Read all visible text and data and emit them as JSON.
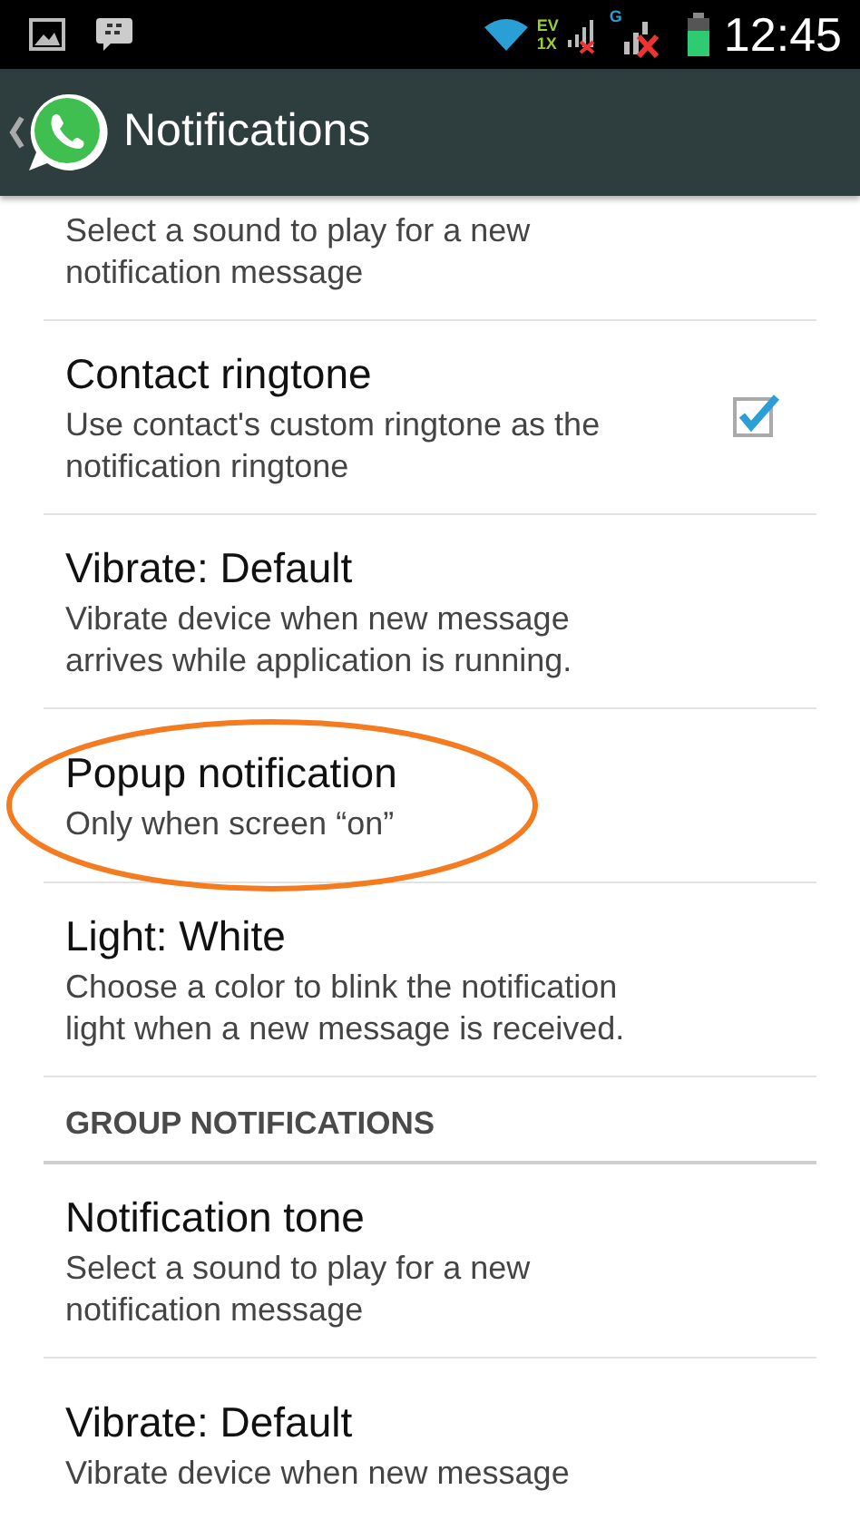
{
  "status_bar": {
    "network_labels": [
      "EV",
      "1X",
      "G"
    ],
    "time": "12:45"
  },
  "action_bar": {
    "title": "Notifications"
  },
  "sections": [
    {
      "items": [
        {
          "kind": "plain",
          "summary": "Select a sound to play for a new notification message"
        },
        {
          "kind": "checkbox",
          "title": "Contact ringtone",
          "summary": "Use contact's custom ringtone as the notification ringtone",
          "checked": true
        },
        {
          "kind": "plain",
          "title": "Vibrate: Default",
          "summary": "Vibrate device when new message arrives while application is running."
        },
        {
          "kind": "plain",
          "title": "Popup notification",
          "summary": "Only when screen “on”",
          "highlighted": true
        },
        {
          "kind": "plain",
          "title": "Light: White",
          "summary": "Choose a color to blink the notification light when a new message is received."
        }
      ]
    },
    {
      "header": "GROUP NOTIFICATIONS",
      "items": [
        {
          "kind": "plain",
          "title": "Notification tone",
          "summary": "Select a sound to play for a new notification message"
        },
        {
          "kind": "plain",
          "title": "Vibrate: Default",
          "summary": "Vibrate device when new message"
        }
      ]
    }
  ]
}
